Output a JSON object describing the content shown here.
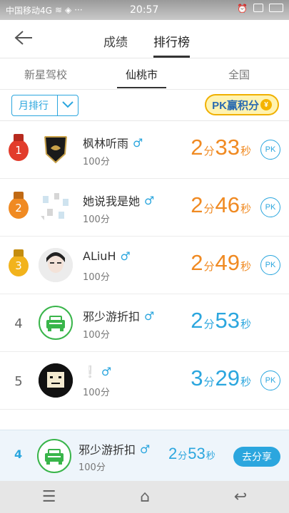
{
  "statusbar": {
    "carrier": "中国移动4G",
    "time": "20:57"
  },
  "header": {
    "tab_scores": "成绩",
    "tab_leaderboard": "排行榜"
  },
  "subtabs": [
    "新星驾校",
    "仙桃市",
    "全国"
  ],
  "filter": {
    "dropdown_label": "月排行",
    "pk_banner": "PK赢积分"
  },
  "rows": [
    {
      "rank": "1",
      "name": "枫林听雨",
      "score": "100分",
      "min": "2",
      "min_unit": "分",
      "sec": "33",
      "sec_unit": "秒",
      "pk": "PK"
    },
    {
      "rank": "2",
      "name": "她说我是她",
      "score": "100分",
      "min": "2",
      "min_unit": "分",
      "sec": "46",
      "sec_unit": "秒",
      "pk": "PK"
    },
    {
      "rank": "3",
      "name": "ALiuH",
      "score": "100分",
      "min": "2",
      "min_unit": "分",
      "sec": "49",
      "sec_unit": "秒",
      "pk": "PK"
    },
    {
      "rank": "4",
      "name": "邪少游折扣",
      "score": "100分",
      "min": "2",
      "min_unit": "分",
      "sec": "53",
      "sec_unit": "秒"
    },
    {
      "rank": "5",
      "name": "❕",
      "score": "100分",
      "min": "3",
      "min_unit": "分",
      "sec": "29",
      "sec_unit": "秒",
      "pk": "PK"
    }
  ],
  "footer": {
    "rank": "4",
    "name": "邪少游折扣",
    "score": "100分",
    "min": "2",
    "min_unit": "分",
    "sec": "53",
    "sec_unit": "秒",
    "share": "去分享"
  },
  "colors": {
    "accent_blue": "#2ba6de",
    "time_orange": "#f08a22"
  }
}
